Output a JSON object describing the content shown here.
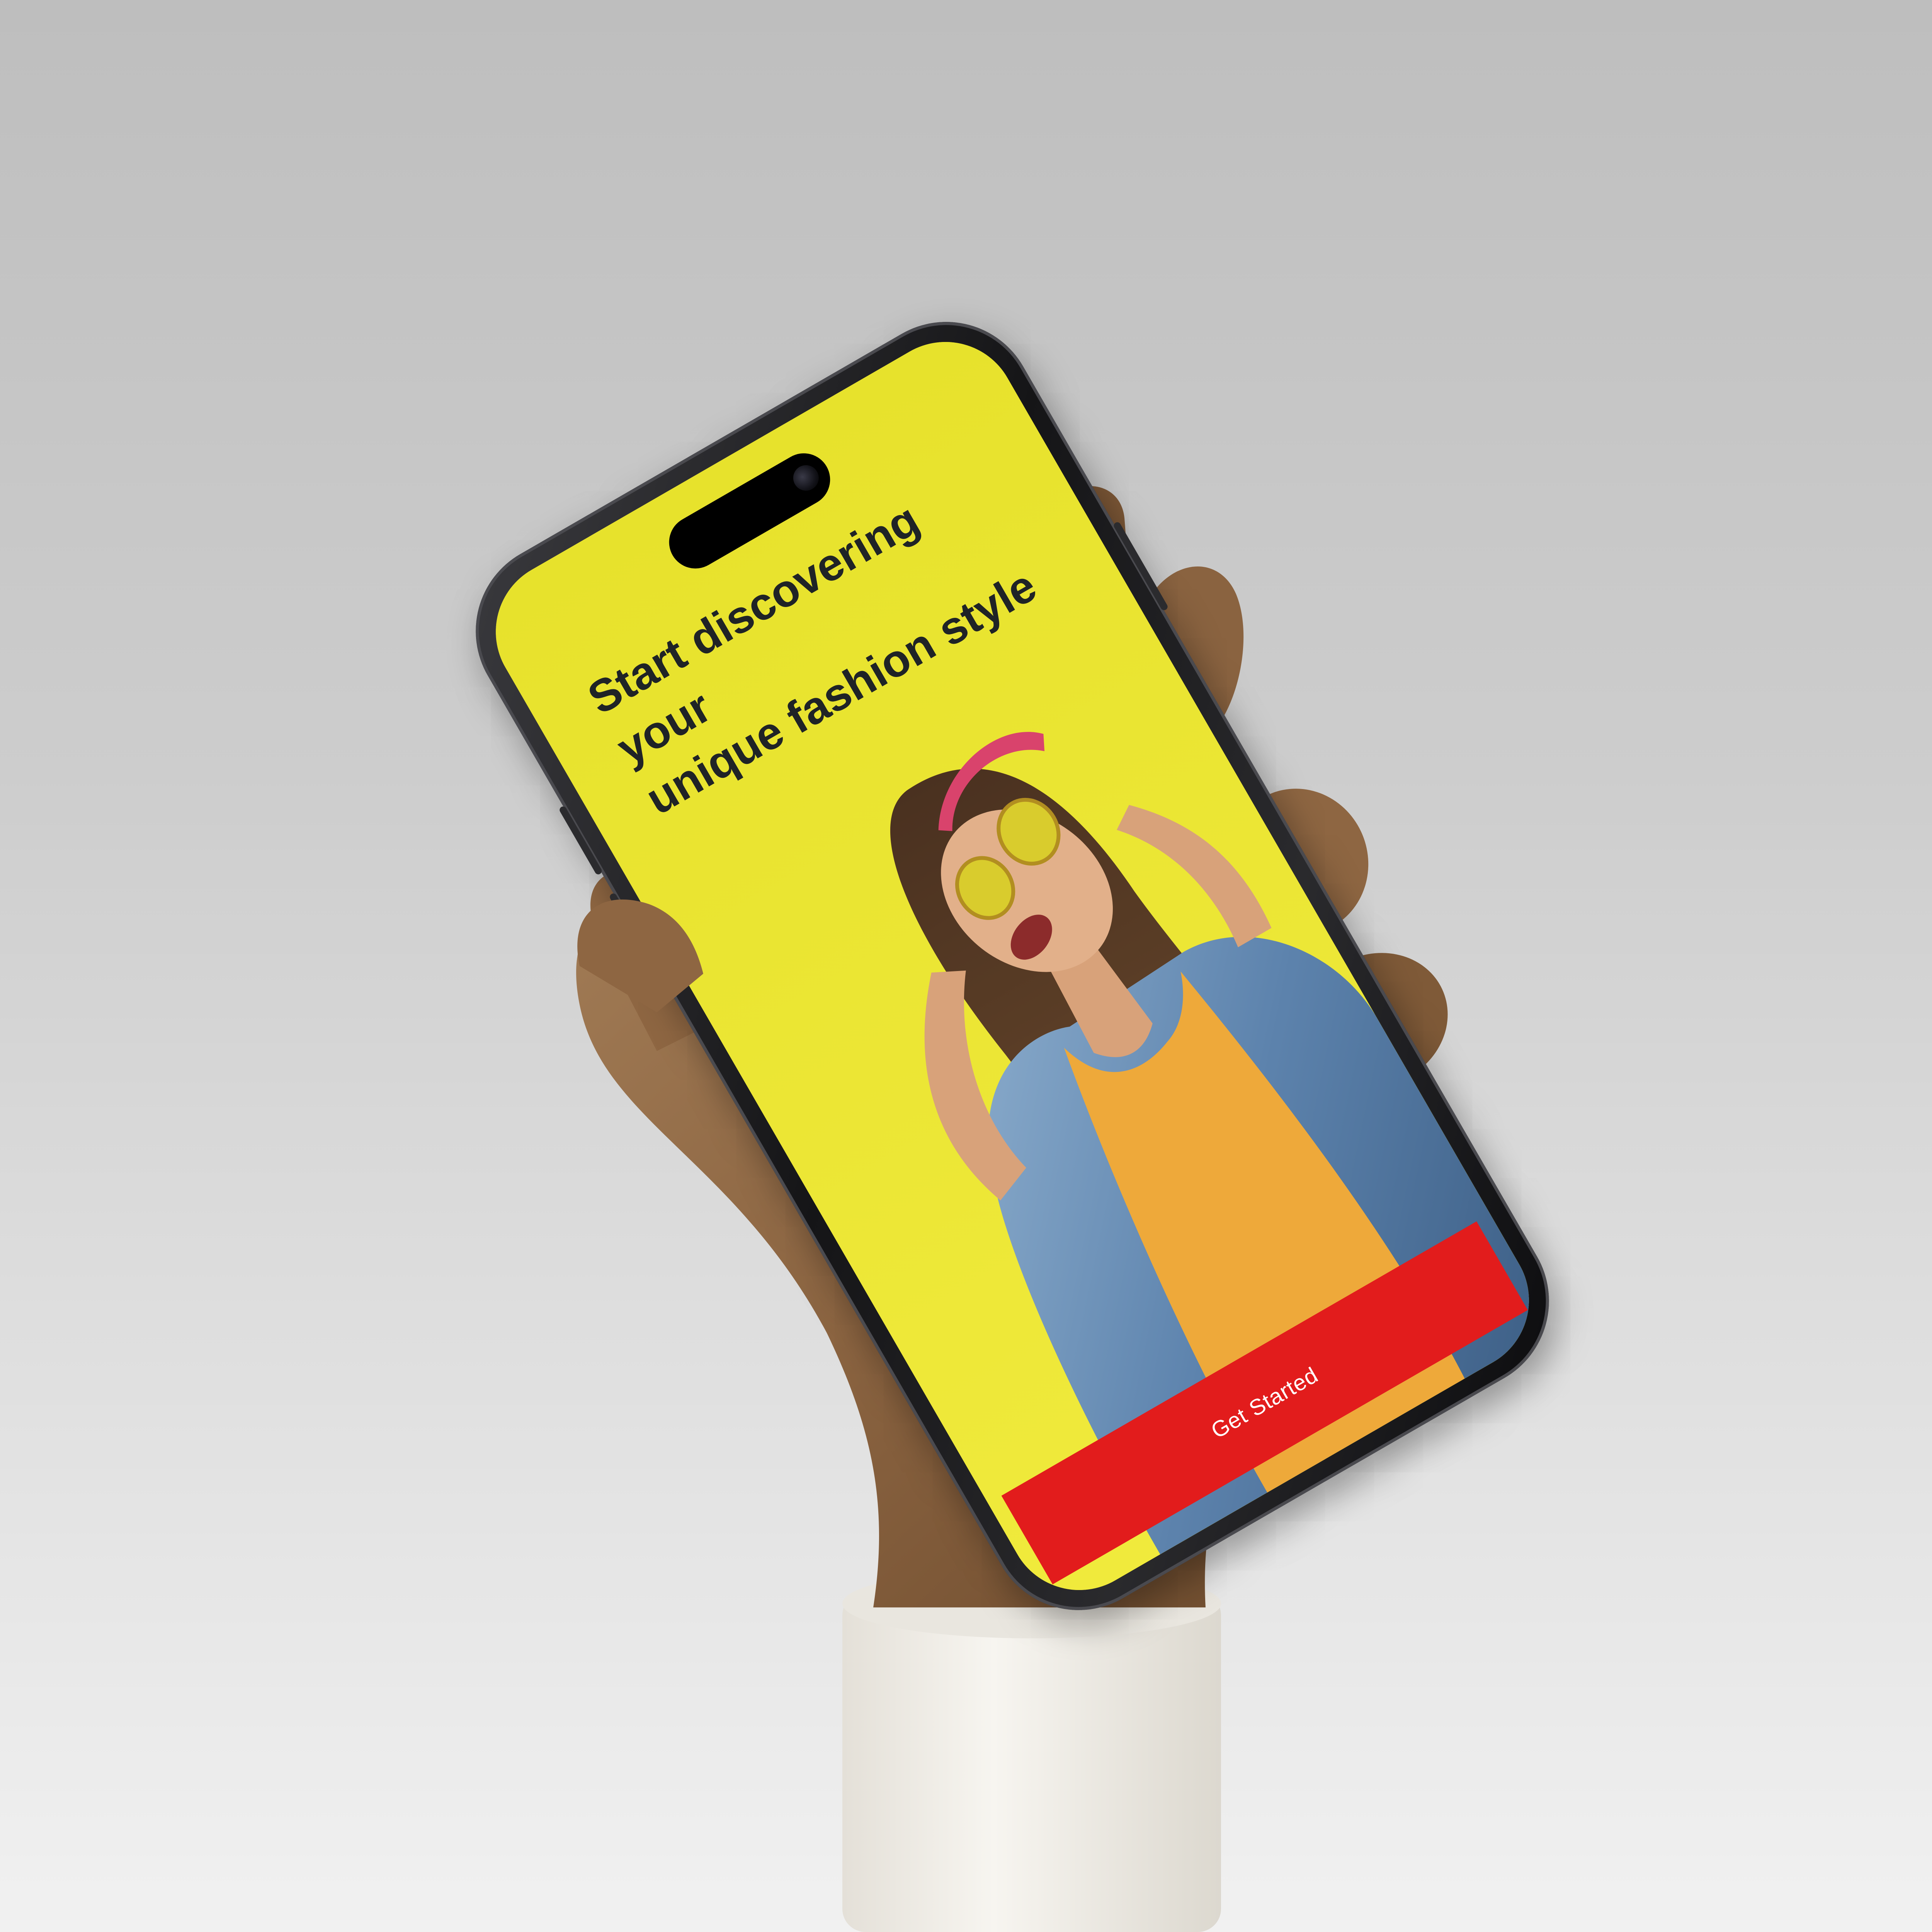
{
  "screen": {
    "headline_line1": "Start discovering your",
    "headline_line2": "unique fashion style",
    "cta_label": "Get Started"
  },
  "colors": {
    "screen_background": "#ece73a",
    "cta_background": "#e21c1c",
    "cta_text": "#ffffff",
    "headline_text": "#1f2326"
  }
}
